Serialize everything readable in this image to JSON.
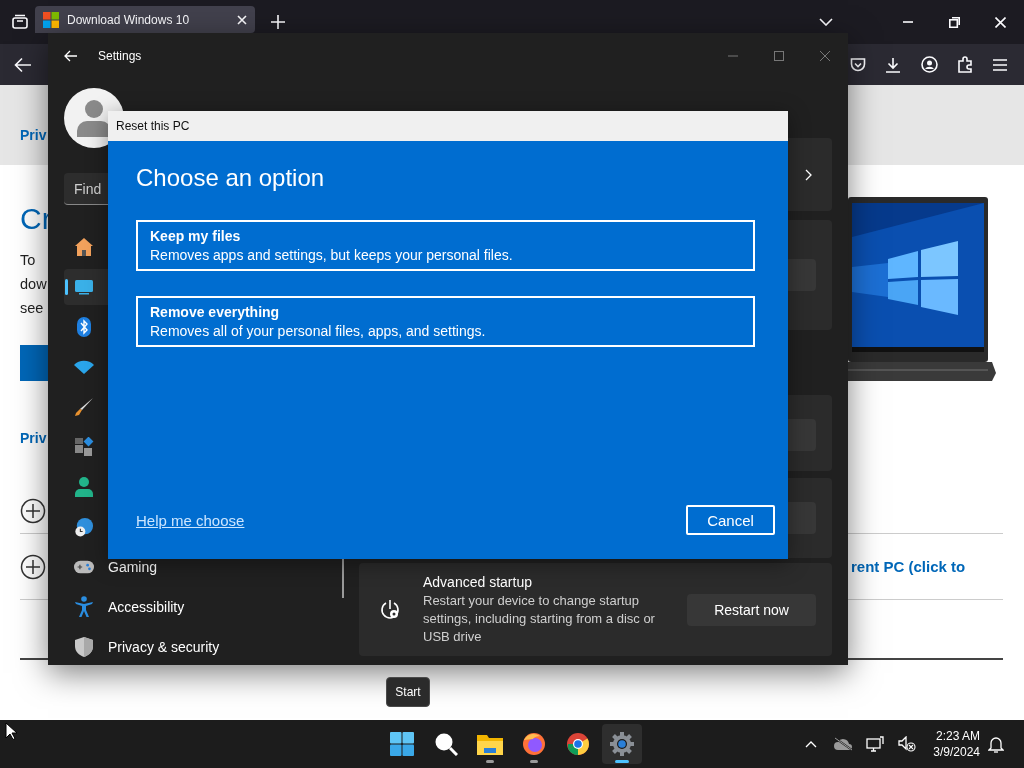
{
  "browser": {
    "tab_title": "Download Windows 10"
  },
  "webpage": {
    "top_link": "Priv",
    "heading": "Cr",
    "paragraph_lines": [
      "To",
      "dow",
      "see"
    ],
    "second_link": "Priv",
    "expand_rows": [
      {
        "kind": "covered"
      },
      {
        "kind": "titled",
        "title": "rent PC (click to"
      }
    ]
  },
  "settings": {
    "title": "Settings",
    "search_placeholder": "Find",
    "nav": [
      {
        "kind": "home",
        "selected": false
      },
      {
        "kind": "system",
        "selected": true
      },
      {
        "kind": "bluetooth",
        "selected": false
      },
      {
        "kind": "network",
        "selected": false
      },
      {
        "kind": "personalization",
        "selected": false
      },
      {
        "kind": "apps",
        "selected": false
      },
      {
        "kind": "accounts",
        "selected": false
      },
      {
        "kind": "time",
        "selected": false
      },
      {
        "kind": "gaming",
        "label": "Gaming",
        "selected": false
      },
      {
        "kind": "accessibility",
        "label": "Accessibility",
        "selected": false
      },
      {
        "kind": "privacy",
        "label": "Privacy & security",
        "selected": false
      }
    ],
    "advanced_startup": {
      "title": "Advanced startup",
      "description": "Restart your device to change startup settings, including starting from a disc or USB drive",
      "button": "Restart now"
    }
  },
  "dialog": {
    "title": "Reset this PC",
    "heading": "Choose an option",
    "options": [
      {
        "title": "Keep my files",
        "description": "Removes apps and settings, but keeps your personal files."
      },
      {
        "title": "Remove everything",
        "description": "Removes all of your personal files, apps, and settings."
      }
    ],
    "help_link": "Help me choose",
    "cancel_button": "Cancel"
  },
  "tooltip": "Start",
  "taskbar": {
    "apps": [
      {
        "kind": "start",
        "running": false,
        "selected": false
      },
      {
        "kind": "search",
        "running": false,
        "selected": false
      },
      {
        "kind": "files",
        "running": true,
        "selected": false
      },
      {
        "kind": "firefox",
        "running": true,
        "selected": false
      },
      {
        "kind": "chrome",
        "running": false,
        "selected": false
      },
      {
        "kind": "settings",
        "running": true,
        "selected": true
      }
    ],
    "clock": {
      "time": "2:23 AM",
      "date": "3/9/2024"
    }
  }
}
